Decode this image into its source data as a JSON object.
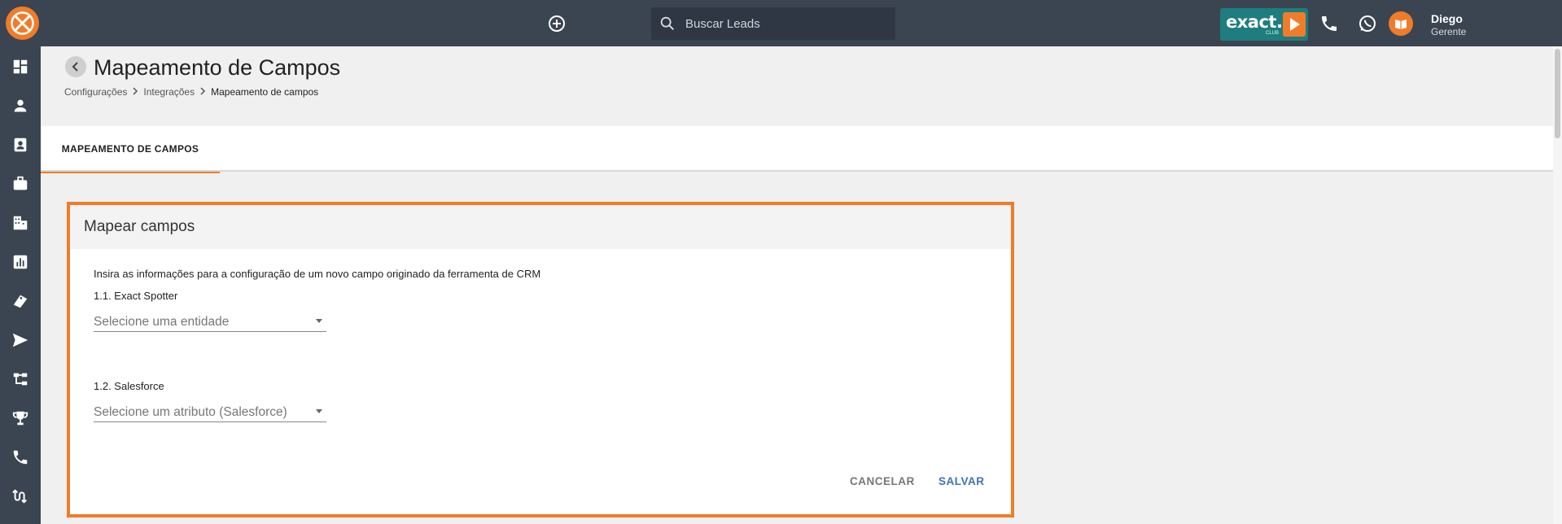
{
  "topbar": {
    "search_placeholder": "Buscar Leads",
    "brand": {
      "word": "exact.",
      "sub": "CLUB"
    },
    "user": {
      "name": "Diego",
      "role": "Gerente"
    }
  },
  "sidebar": {
    "items": [
      {
        "icon": "dashboard-icon"
      },
      {
        "icon": "person-icon"
      },
      {
        "icon": "contact-card-icon"
      },
      {
        "icon": "briefcase-icon"
      },
      {
        "icon": "building-icon"
      },
      {
        "icon": "bar-chart-icon"
      },
      {
        "icon": "tag-icon"
      },
      {
        "icon": "send-icon"
      },
      {
        "icon": "hierarchy-icon"
      },
      {
        "icon": "trophy-icon"
      },
      {
        "icon": "phone-icon"
      },
      {
        "icon": "integration-icon"
      }
    ]
  },
  "header": {
    "title": "Mapeamento de Campos",
    "breadcrumb": [
      "Configurações",
      "Integrações",
      "Mapeamento de campos"
    ]
  },
  "tabs": [
    {
      "label": "MAPEAMENTO DE CAMPOS",
      "active": true
    }
  ],
  "card": {
    "title": "Mapear campos",
    "intro": "Insira as informações para a configuração de um novo campo originado da ferramenta de CRM",
    "section1_label": "1.1. Exact Spotter",
    "entity_select_placeholder": "Selecione uma entidade",
    "section2_label": "1.2. Salesforce",
    "attribute_select_placeholder": "Selecione um atributo (Salesforce)",
    "cancel_label": "CANCELAR",
    "save_label": "SALVAR"
  },
  "colors": {
    "topbar_bg": "#3b4552",
    "accent_orange": "#f07c2a",
    "save_blue": "#3c74b3",
    "brand_teal": "#1e7d7e"
  }
}
